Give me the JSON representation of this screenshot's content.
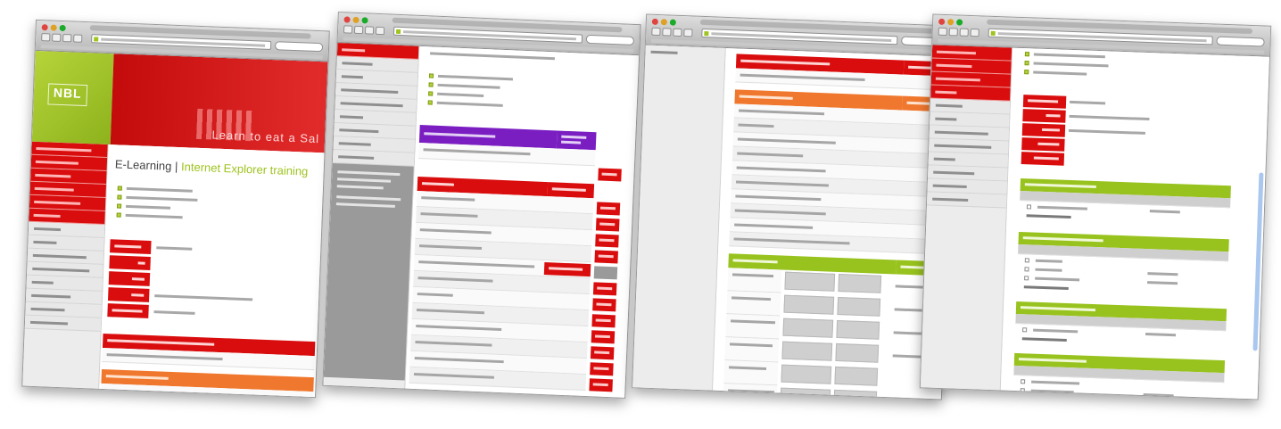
{
  "logo": {
    "text": "NBL"
  },
  "header": {
    "caption": "Learn to eat a Sal"
  },
  "page": {
    "title_part1": "E-Learning",
    "separator": "|",
    "title_part2": "Internet Explorer training"
  },
  "colors": {
    "primary_red": "#d90d0d",
    "brand_green": "#98c31e",
    "accent_orange": "#f0782e",
    "accent_purple": "#7a1ec2"
  }
}
